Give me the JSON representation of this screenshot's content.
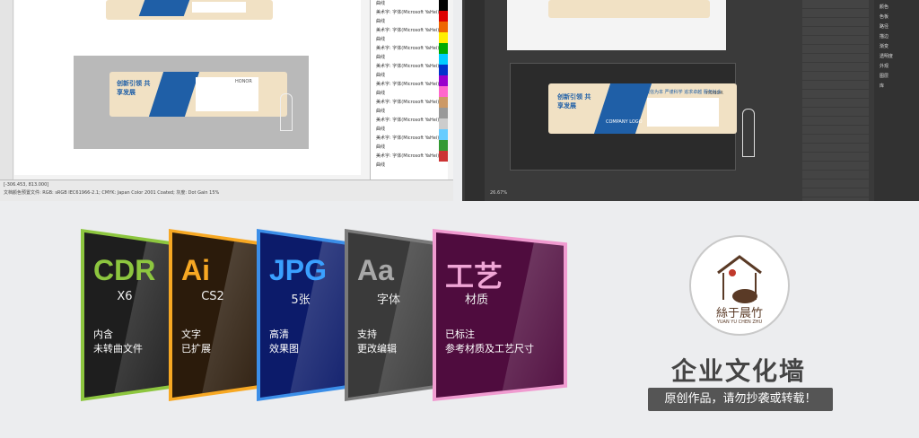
{
  "left_screenshot": {
    "status_line_1": "[-306.453, 813.000]",
    "status_line_2": "文档颜色预置文件: RGB: sRGB IEC61966-2.1; CMYK: Japan Color 2001 Coated; 灰度: Dot Gain 15%",
    "object_rows": [
      "曲线",
      "美术字: 字体(Microsoft YaHei)-加粗",
      "曲线",
      "美术字: 字体(Microsoft YaHei)-加粗",
      "曲线",
      "美术字: 字体(Microsoft YaHei)-加粗",
      "曲线",
      "美术字: 字体(Microsoft YaHei)-加粗",
      "曲线",
      "美术字: 字体(Microsoft YaHei)-加粗",
      "曲线",
      "美术字: 字体(Microsoft YaHei)-加粗",
      "曲线",
      "美术字: 字体(Microsoft YaHei)-加粗",
      "曲线",
      "美术字: 字体(Microsoft YaHei)-加粗",
      "曲线",
      "美术字: 字体(Microsoft YaHei)-加粗",
      "曲线"
    ]
  },
  "board": {
    "headline": "创新引领 共享发展",
    "slogans": "诚信为本 严谨科学 追求卓越 服务社会",
    "honor": "HONOR",
    "company": "COMPANY LOGO"
  },
  "right_screenshot": {
    "zoom": "26.67%",
    "panel_items": [
      "颜色",
      "色板",
      "路径",
      "描边",
      "渐变",
      "透明度",
      "外观",
      "图层",
      "库"
    ]
  },
  "cards": [
    {
      "title": "CDR",
      "sub": "X6",
      "line1": "内含",
      "line2": "未转曲文件",
      "title_color": "#8dc63f",
      "border": "#8dc63f",
      "bg": "#1e1e1e"
    },
    {
      "title": "Ai",
      "sub": "CS2",
      "line1": "文字",
      "line2": "已扩展",
      "title_color": "#f7a823",
      "border": "#f7a823",
      "bg": "#2b1b0b"
    },
    {
      "title": "JPG",
      "sub": "5张",
      "line1": "高清",
      "line2": "效果图",
      "title_color": "#3aa0ff",
      "border": "#3b8ee8",
      "bg": "#0c1b6a"
    },
    {
      "title": "Aa",
      "sub": "字体",
      "line1": "支持",
      "line2": "更改编辑",
      "title_color": "#a8a8a8",
      "border": "#7a7a7a",
      "bg": "#3a3a3a"
    },
    {
      "title": "工艺",
      "sub": "材质",
      "line1": "已标注",
      "line2": "参考材质及工艺尺寸",
      "title_color": "#f0a6d6",
      "border": "#f09bd0",
      "bg": "#4f0c3e"
    }
  ],
  "logo": {
    "name": "絲于晨竹",
    "sub": "YUAN YU CHEN ZHU"
  },
  "banner": {
    "title": "企业文化墙",
    "note": "原创作品，请勿抄袭或转载！"
  }
}
